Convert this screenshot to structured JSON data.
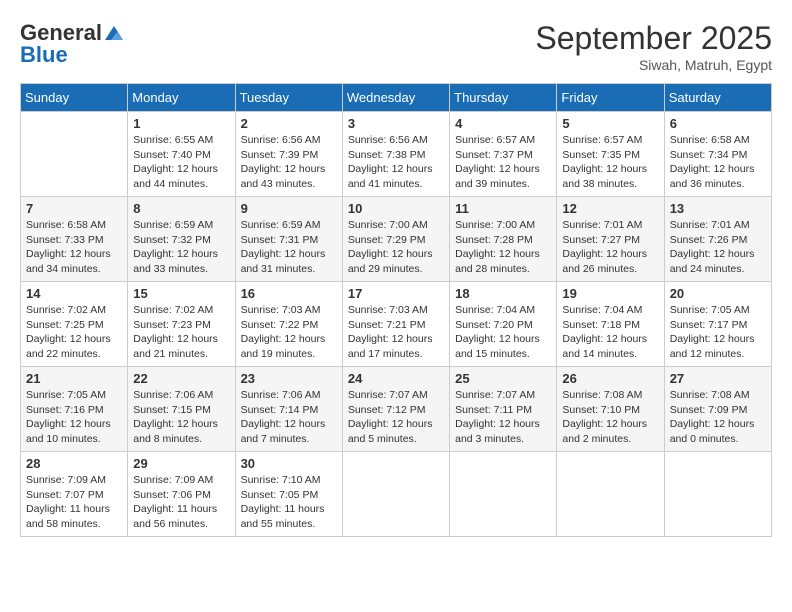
{
  "header": {
    "logo_general": "General",
    "logo_blue": "Blue",
    "month": "September 2025",
    "location": "Siwah, Matruh, Egypt"
  },
  "weekdays": [
    "Sunday",
    "Monday",
    "Tuesday",
    "Wednesday",
    "Thursday",
    "Friday",
    "Saturday"
  ],
  "weeks": [
    [
      {
        "day": "",
        "info": ""
      },
      {
        "day": "1",
        "info": "Sunrise: 6:55 AM\nSunset: 7:40 PM\nDaylight: 12 hours\nand 44 minutes."
      },
      {
        "day": "2",
        "info": "Sunrise: 6:56 AM\nSunset: 7:39 PM\nDaylight: 12 hours\nand 43 minutes."
      },
      {
        "day": "3",
        "info": "Sunrise: 6:56 AM\nSunset: 7:38 PM\nDaylight: 12 hours\nand 41 minutes."
      },
      {
        "day": "4",
        "info": "Sunrise: 6:57 AM\nSunset: 7:37 PM\nDaylight: 12 hours\nand 39 minutes."
      },
      {
        "day": "5",
        "info": "Sunrise: 6:57 AM\nSunset: 7:35 PM\nDaylight: 12 hours\nand 38 minutes."
      },
      {
        "day": "6",
        "info": "Sunrise: 6:58 AM\nSunset: 7:34 PM\nDaylight: 12 hours\nand 36 minutes."
      }
    ],
    [
      {
        "day": "7",
        "info": "Sunrise: 6:58 AM\nSunset: 7:33 PM\nDaylight: 12 hours\nand 34 minutes."
      },
      {
        "day": "8",
        "info": "Sunrise: 6:59 AM\nSunset: 7:32 PM\nDaylight: 12 hours\nand 33 minutes."
      },
      {
        "day": "9",
        "info": "Sunrise: 6:59 AM\nSunset: 7:31 PM\nDaylight: 12 hours\nand 31 minutes."
      },
      {
        "day": "10",
        "info": "Sunrise: 7:00 AM\nSunset: 7:29 PM\nDaylight: 12 hours\nand 29 minutes."
      },
      {
        "day": "11",
        "info": "Sunrise: 7:00 AM\nSunset: 7:28 PM\nDaylight: 12 hours\nand 28 minutes."
      },
      {
        "day": "12",
        "info": "Sunrise: 7:01 AM\nSunset: 7:27 PM\nDaylight: 12 hours\nand 26 minutes."
      },
      {
        "day": "13",
        "info": "Sunrise: 7:01 AM\nSunset: 7:26 PM\nDaylight: 12 hours\nand 24 minutes."
      }
    ],
    [
      {
        "day": "14",
        "info": "Sunrise: 7:02 AM\nSunset: 7:25 PM\nDaylight: 12 hours\nand 22 minutes."
      },
      {
        "day": "15",
        "info": "Sunrise: 7:02 AM\nSunset: 7:23 PM\nDaylight: 12 hours\nand 21 minutes."
      },
      {
        "day": "16",
        "info": "Sunrise: 7:03 AM\nSunset: 7:22 PM\nDaylight: 12 hours\nand 19 minutes."
      },
      {
        "day": "17",
        "info": "Sunrise: 7:03 AM\nSunset: 7:21 PM\nDaylight: 12 hours\nand 17 minutes."
      },
      {
        "day": "18",
        "info": "Sunrise: 7:04 AM\nSunset: 7:20 PM\nDaylight: 12 hours\nand 15 minutes."
      },
      {
        "day": "19",
        "info": "Sunrise: 7:04 AM\nSunset: 7:18 PM\nDaylight: 12 hours\nand 14 minutes."
      },
      {
        "day": "20",
        "info": "Sunrise: 7:05 AM\nSunset: 7:17 PM\nDaylight: 12 hours\nand 12 minutes."
      }
    ],
    [
      {
        "day": "21",
        "info": "Sunrise: 7:05 AM\nSunset: 7:16 PM\nDaylight: 12 hours\nand 10 minutes."
      },
      {
        "day": "22",
        "info": "Sunrise: 7:06 AM\nSunset: 7:15 PM\nDaylight: 12 hours\nand 8 minutes."
      },
      {
        "day": "23",
        "info": "Sunrise: 7:06 AM\nSunset: 7:14 PM\nDaylight: 12 hours\nand 7 minutes."
      },
      {
        "day": "24",
        "info": "Sunrise: 7:07 AM\nSunset: 7:12 PM\nDaylight: 12 hours\nand 5 minutes."
      },
      {
        "day": "25",
        "info": "Sunrise: 7:07 AM\nSunset: 7:11 PM\nDaylight: 12 hours\nand 3 minutes."
      },
      {
        "day": "26",
        "info": "Sunrise: 7:08 AM\nSunset: 7:10 PM\nDaylight: 12 hours\nand 2 minutes."
      },
      {
        "day": "27",
        "info": "Sunrise: 7:08 AM\nSunset: 7:09 PM\nDaylight: 12 hours\nand 0 minutes."
      }
    ],
    [
      {
        "day": "28",
        "info": "Sunrise: 7:09 AM\nSunset: 7:07 PM\nDaylight: 11 hours\nand 58 minutes."
      },
      {
        "day": "29",
        "info": "Sunrise: 7:09 AM\nSunset: 7:06 PM\nDaylight: 11 hours\nand 56 minutes."
      },
      {
        "day": "30",
        "info": "Sunrise: 7:10 AM\nSunset: 7:05 PM\nDaylight: 11 hours\nand 55 minutes."
      },
      {
        "day": "",
        "info": ""
      },
      {
        "day": "",
        "info": ""
      },
      {
        "day": "",
        "info": ""
      },
      {
        "day": "",
        "info": ""
      }
    ]
  ]
}
